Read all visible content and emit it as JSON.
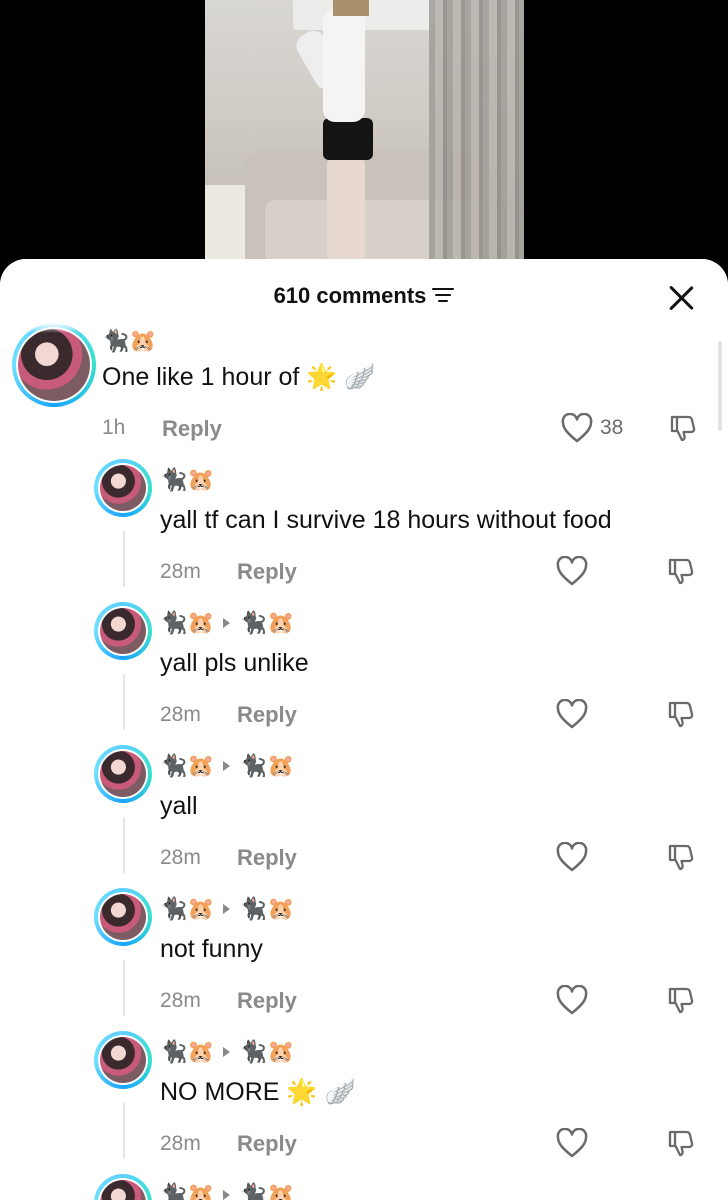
{
  "header": {
    "comments_count": "610 comments",
    "filter_icon": "filter-lines-icon",
    "close_icon": "close-icon"
  },
  "comments": [
    {
      "name": "🐈‍⬛🐹",
      "reply_to": "",
      "text": "One like 1 hour of 🌟 🪽",
      "time": "1h",
      "reply_label": "Reply",
      "likes": "38"
    },
    {
      "name": "🐈‍⬛🐹",
      "reply_to": "",
      "text": "yall tf can I survive 18 hours without food",
      "time": "28m",
      "reply_label": "Reply",
      "likes": ""
    },
    {
      "name": "🐈‍⬛🐹",
      "reply_to": "🐈‍⬛🐹",
      "text": "yall pls unlike",
      "time": "28m",
      "reply_label": "Reply",
      "likes": ""
    },
    {
      "name": "🐈‍⬛🐹",
      "reply_to": "🐈‍⬛🐹",
      "text": "yall",
      "time": "28m",
      "reply_label": "Reply",
      "likes": ""
    },
    {
      "name": "🐈‍⬛🐹",
      "reply_to": "🐈‍⬛🐹",
      "text": "not funny",
      "time": "28m",
      "reply_label": "Reply",
      "likes": ""
    },
    {
      "name": "🐈‍⬛🐹",
      "reply_to": "🐈‍⬛🐹",
      "text": "NO MORE 🌟 🪽",
      "time": "28m",
      "reply_label": "Reply",
      "likes": ""
    },
    {
      "name": "🐈‍⬛🐹",
      "reply_to": "🐈‍⬛🐹",
      "text": "",
      "time": "",
      "reply_label": "",
      "likes": ""
    }
  ],
  "colors": {
    "avatar_ring": "#38e2c9",
    "meta_gray": "#8a8a8a",
    "sheet_bg": "#ffffff"
  }
}
